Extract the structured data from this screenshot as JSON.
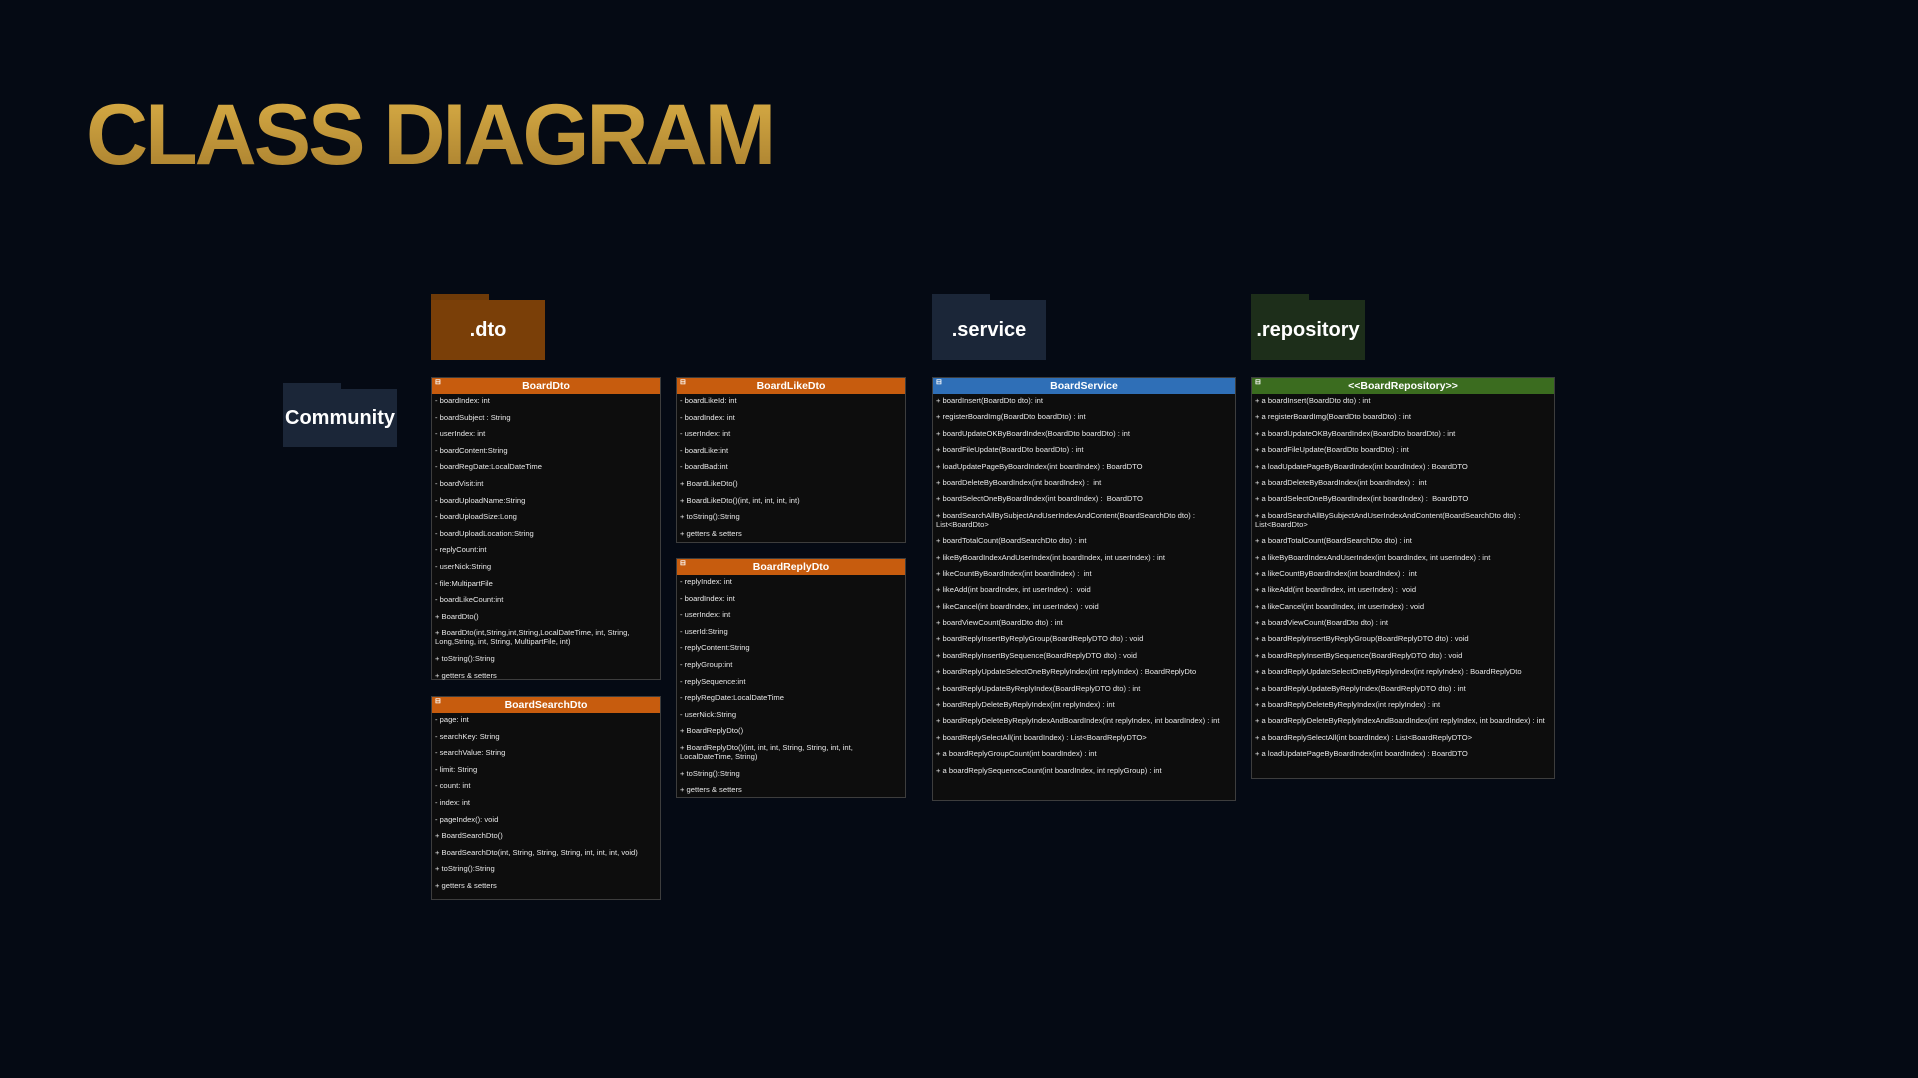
{
  "title": "CLASS DIAGRAM",
  "packages": {
    "community": "Community",
    "dto": ".dto",
    "service": ".service",
    "repository": ".repository"
  },
  "colors": {
    "title": "#c49a3c",
    "dto": "#c75c0e",
    "service": "#2f6fb7",
    "repository": "#3b6c1f",
    "community_folder": "#1b2638"
  },
  "classes": {
    "board_dto": {
      "name": "BoardDto",
      "members": [
        "- boardIndex: int",
        "- boardSubject : String",
        "- userIndex: int",
        "- boardContent:String",
        "- boardRegDate:LocalDateTime",
        "- boardVisit:int",
        "- boardUploadName:String",
        "- boardUploadSize:Long",
        "- boardUploadLocation:String",
        "- replyCount:int",
        "- userNick:String",
        "- file:MultipartFile",
        "- boardLikeCount:int",
        "+ BoardDto()",
        "+ BoardDto(int,String,int,String,LocalDateTime, int, String, Long,String, int, String, MultipartFile, int)",
        "+ toString():String",
        "+ getters & setters"
      ]
    },
    "board_search_dto": {
      "name": "BoardSearchDto",
      "members": [
        "- page: int",
        "- searchKey: String",
        "- searchValue: String",
        "- limit: String",
        "- count: int",
        "- index: int",
        "- pageIndex(): void",
        "+ BoardSearchDto()",
        "+ BoardSearchDto(int, String, String, String, int, int, int, void)",
        "+ toString():String",
        "+ getters & setters"
      ]
    },
    "board_like_dto": {
      "name": "BoardLikeDto",
      "members": [
        "- boardLikeId: int",
        "- boardIndex: int",
        "- userIndex: int",
        "- boardLike:int",
        "- boardBad:int",
        "+ BoardLikeDto()",
        "+ BoardLikeDto()(int, int, int, int, int)",
        "+ toString():String",
        "+ getters & setters"
      ]
    },
    "board_reply_dto": {
      "name": "BoardReplyDto",
      "members": [
        "- replyIndex: int",
        "- boardIndex: int",
        "- userIndex: int",
        "- userId:String",
        "- replyContent:String",
        "- replyGroup:int",
        "- replySequence:int",
        "- replyRegDate:LocalDateTime",
        "- userNick:String",
        "+ BoardReplyDto()",
        "+ BoardReplyDto()(int, int, int, String, String, int, int, LocalDateTime, String)",
        "+ toString():String",
        "+ getters & setters"
      ]
    },
    "board_service": {
      "name": "BoardService",
      "members": [
        "+ boardInsert(BoardDto dto): int",
        "+ registerBoardImg(BoardDto boardDto) : int",
        "+ boardUpdateOKByBoardIndex(BoardDto boardDto) : int",
        "+ boardFileUpdate(BoardDto boardDto) : int",
        "+ loadUpdatePageByBoardIndex(int boardIndex) : BoardDTO",
        "+ boardDeleteByBoardIndex(int boardIndex) :  int",
        "+ boardSelectOneByBoardIndex(int boardIndex) :  BoardDTO",
        "+ boardSearchAllBySubjectAndUserIndexAndContent(BoardSearchDto dto) : List<BoardDto>",
        "+ boardTotalCount(BoardSearchDto dto) : int",
        "+ likeByBoardIndexAndUserIndex(int boardIndex, int userIndex) : int",
        "+ likeCountByBoardIndex(int boardIndex) :  int",
        "+ likeAdd(int boardIndex, int userIndex) :  void",
        "+ likeCancel(int boardIndex, int userIndex) : void",
        "+ boardViewCount(BoardDto dto) : int",
        "+ boardReplyInsertByReplyGroup(BoardReplyDTO dto) : void",
        "+ boardReplyInsertBySequence(BoardReplyDTO dto) : void",
        "+ boardReplyUpdateSelectOneByReplyIndex(int replyIndex) : BoardReplyDto",
        "+ boardReplyUpdateByReplyIndex(BoardReplyDTO dto) : int",
        "+ boardReplyDeleteByReplyIndex(int replyIndex) : int",
        "+ boardReplyDeleteByReplyIndexAndBoardIndex(int replyIndex, int boardIndex) : int",
        "+ boardReplySelectAll(int boardIndex) : List<BoardReplyDTO>",
        "+ a boardReplyGroupCount(int boardIndex) : int",
        "+ a boardReplySequenceCount(int boardIndex, int replyGroup) : int"
      ]
    },
    "board_repository": {
      "name": "<<BoardRepository>>",
      "members": [
        "+ a boardInsert(BoardDto dto) : int",
        "+ a registerBoardImg(BoardDto boardDto) : int",
        "+ a boardUpdateOKByBoardIndex(BoardDto boardDto) : int",
        "+ a boardFileUpdate(BoardDto boardDto) : int",
        "+ a loadUpdatePageByBoardIndex(int boardIndex) : BoardDTO",
        "+ a boardDeleteByBoardIndex(int boardIndex) :  int",
        "+ a boardSelectOneByBoardIndex(int boardIndex) :  BoardDTO",
        "+ a boardSearchAllBySubjectAndUserIndexAndContent(BoardSearchDto dto) : List<BoardDto>",
        "+ a boardTotalCount(BoardSearchDto dto) : int",
        "+ a likeByBoardIndexAndUserIndex(int boardIndex, int userIndex) : int",
        "+ a likeCountByBoardIndex(int boardIndex) :  int",
        "+ a likeAdd(int boardIndex, int userIndex) :  void",
        "+ a likeCancel(int boardIndex, int userIndex) : void",
        "+ a boardViewCount(BoardDto dto) : int",
        "+ a boardReplyInsertByReplyGroup(BoardReplyDTO dto) : void",
        "+ a boardReplyInsertBySequence(BoardReplyDTO dto) : void",
        "+ a boardReplyUpdateSelectOneByReplyIndex(int replyIndex) : BoardReplyDto",
        "+ a boardReplyUpdateByReplyIndex(BoardReplyDTO dto) : int",
        "+ a boardReplyDeleteByReplyIndex(int replyIndex) : int",
        "+ a boardReplyDeleteByReplyIndexAndBoardIndex(int replyIndex, int boardIndex) : int",
        "+ a boardReplySelectAll(int boardIndex) : List<BoardReplyDTO>",
        "+ a loadUpdatePageByBoardIndex(int boardIndex) : BoardDTO"
      ]
    }
  }
}
